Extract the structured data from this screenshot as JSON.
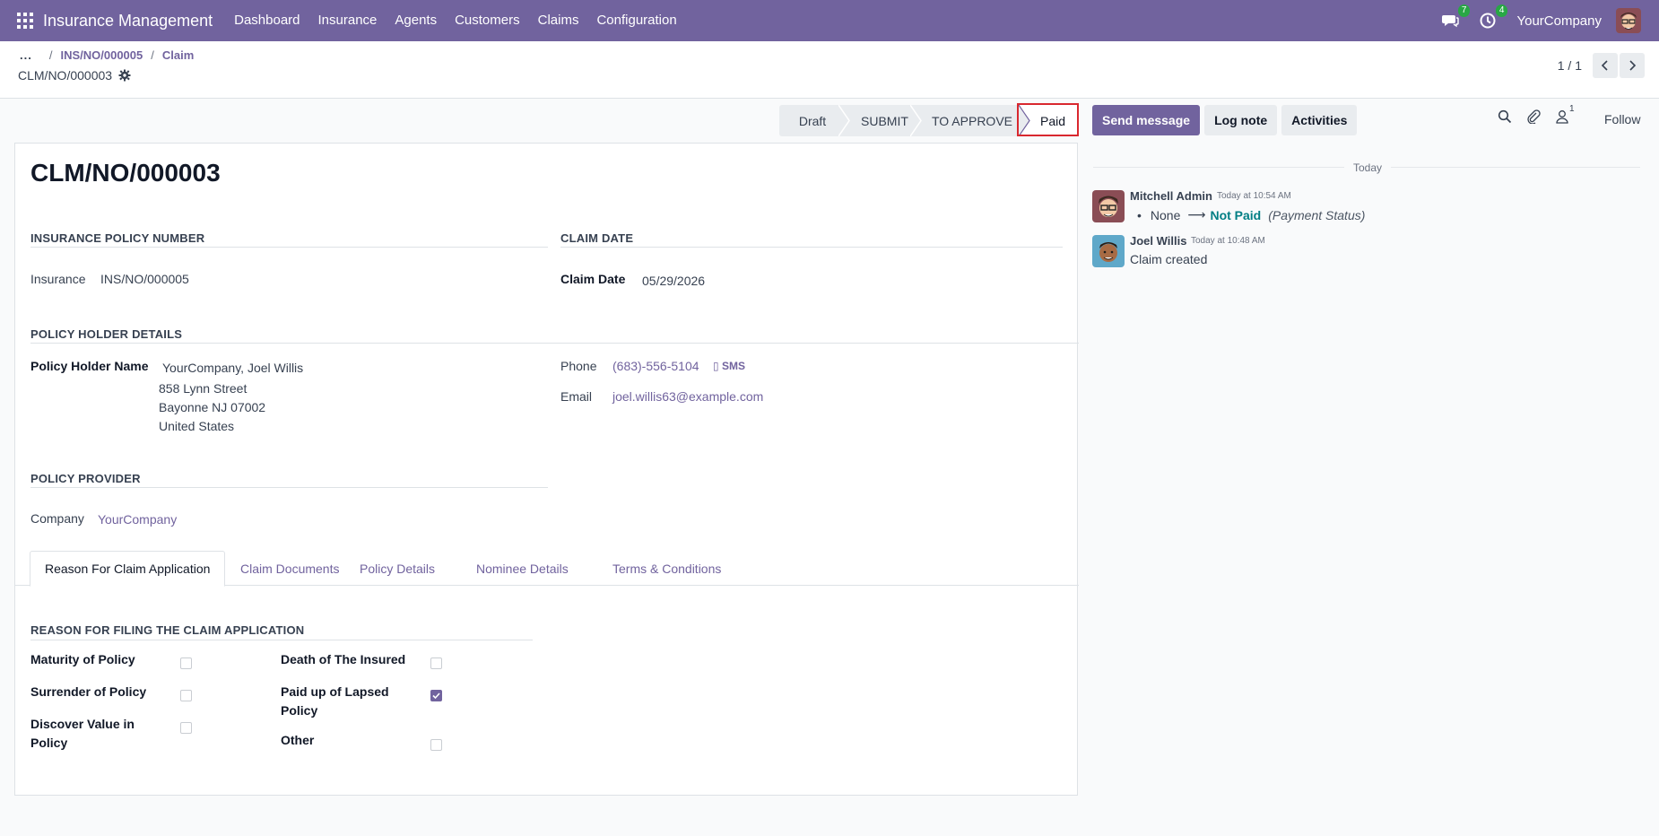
{
  "navbar": {
    "app_name": "Insurance Management",
    "menu": [
      "Dashboard",
      "Insurance",
      "Agents",
      "Customers",
      "Claims",
      "Configuration"
    ],
    "messages_count": "7",
    "activities_count": "4",
    "company": "YourCompany"
  },
  "breadcrumb": {
    "dots": "...",
    "items": [
      "INS/NO/000005",
      "Claim"
    ],
    "current": "CLM/NO/000003"
  },
  "pager": {
    "value": "1 / 1"
  },
  "statusbar": {
    "stages": [
      "Draft",
      "SUBMIT",
      "TO APPROVE",
      "Paid"
    ],
    "active": "Paid"
  },
  "form": {
    "name": "CLM/NO/000003",
    "insurance_group": "INSURANCE POLICY NUMBER",
    "insurance_label": "Insurance",
    "insurance_value": "INS/NO/000005",
    "claim_date_group": "CLAIM DATE",
    "claim_date_label": "Claim Date",
    "claim_date_value": "05/29/2026",
    "holder_group": "POLICY HOLDER DETAILS",
    "holder_label": "Policy Holder Name",
    "holder_name": "YourCompany, Joel Willis",
    "holder_street": "858 Lynn Street",
    "holder_city": "Bayonne NJ 07002",
    "holder_country": "United States",
    "phone_label": "Phone",
    "phone_value": "(683)-556-5104",
    "sms_label": "SMS",
    "email_label": "Email",
    "email_value": "joel.willis63@example.com",
    "provider_group": "POLICY PROVIDER",
    "company_label": "Company",
    "company_value": "YourCompany"
  },
  "tabs": [
    "Reason For Claim Application",
    "Claim Documents",
    "Policy Details",
    "Nominee Details",
    "Terms & Conditions"
  ],
  "reason": {
    "title": "REASON FOR FILING THE CLAIM APPLICATION",
    "items": [
      {
        "label": "Maturity of Policy",
        "checked": false
      },
      {
        "label": "Surrender of Policy",
        "checked": false
      },
      {
        "label": "Discover Value in Policy",
        "checked": false
      },
      {
        "label": "Death of The Insured",
        "checked": false
      },
      {
        "label": "Paid up of Lapsed Policy",
        "checked": true
      },
      {
        "label": "Other",
        "checked": false
      }
    ]
  },
  "chatter": {
    "send_message": "Send message",
    "log_note": "Log note",
    "activities": "Activities",
    "followers_count": "1",
    "follow": "Follow",
    "today": "Today",
    "messages": [
      {
        "author": "Mitchell Admin",
        "time": "Today at 10:54 AM",
        "old_value": "None",
        "new_value": "Not Paid",
        "field": "(Payment Status)"
      },
      {
        "author": "Joel Willis",
        "time": "Today at 10:48 AM",
        "body": "Claim created"
      }
    ]
  },
  "colors": {
    "brand": "#71639e",
    "status_highlight": "#d9282f",
    "badge": "#28a745"
  }
}
